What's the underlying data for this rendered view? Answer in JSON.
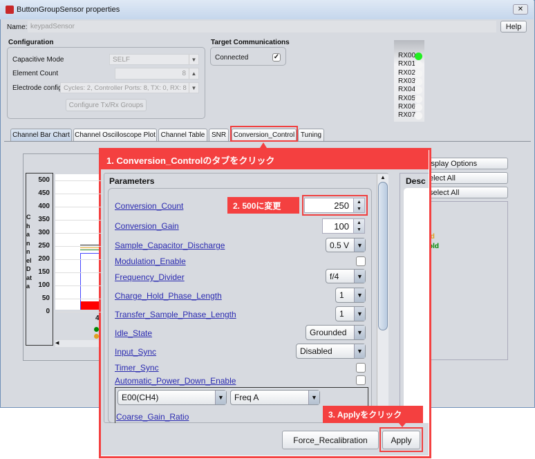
{
  "window": {
    "title": "ButtonGroupSensor properties",
    "help": "Help"
  },
  "name": {
    "label": "Name:",
    "value": "keypadSensor"
  },
  "configuration": {
    "title": "Configuration",
    "capacitive_mode_label": "Capacitive Mode",
    "capacitive_mode": "SELF",
    "element_count_label": "Element Count",
    "element_count": "8",
    "electrode_label": "Electrode config",
    "electrode": "Cycles:  2, Controller Ports:  8, TX:  0, RX:  8",
    "configure_button": "Configure Tx/Rx Groups"
  },
  "target": {
    "title": "Target Communications",
    "connected_label": "Connected",
    "connected": true
  },
  "rx": [
    {
      "label": "RX00",
      "active": true
    },
    {
      "label": "RX01",
      "active": false
    },
    {
      "label": "RX02",
      "active": false
    },
    {
      "label": "RX03",
      "active": false
    },
    {
      "label": "RX04",
      "active": false
    },
    {
      "label": "RX05",
      "active": false
    },
    {
      "label": "RX06",
      "active": false
    },
    {
      "label": "RX07",
      "active": false
    }
  ],
  "tabs": [
    "Channel Bar Chart",
    "Channel Oscilloscope Plot",
    "Channel Table",
    "SNR",
    "Conversion_Control",
    "Tuning"
  ],
  "chart": {
    "ylabel": "Channel Data",
    "yticks": [
      "500",
      "450",
      "400",
      "350",
      "300",
      "250",
      "200",
      "150",
      "100",
      "50",
      "0"
    ],
    "xtick": "4"
  },
  "side": {
    "display_options": "isplay Options",
    "select_all": "elect All",
    "deselect_all": "select All",
    "legend1": "ld",
    "legend2": "old",
    "desc": "Desc"
  },
  "annotations": {
    "step1": "1. Conversion_Controlのタブをクリック",
    "step2": "2. 500に変更",
    "step3": "3. Applyをクリック"
  },
  "parameters": {
    "title": "Parameters",
    "conversion_count_label": "Conversion_Count",
    "conversion_count": "250",
    "conversion_gain_label": "Conversion_Gain",
    "conversion_gain": "100",
    "sample_cap_label": "Sample_Capacitor_Discharge",
    "sample_cap": "0.5 V",
    "modulation_label": "Modulation_Enable",
    "freq_div_label": "Frequency_Divider",
    "freq_div": "f/4",
    "charge_hold_label": "Charge_Hold_Phase_Length",
    "charge_hold": "1",
    "transfer_label": "Transfer_Sample_Phase_Length",
    "transfer": "1",
    "idle_label": "Idle_State",
    "idle": "Grounded",
    "input_sync_label": "Input_Sync",
    "input_sync": "Disabled",
    "timer_sync_label": "Timer_Sync",
    "apd_label": "Automatic_Power_Down_Enable",
    "element_select": "E00(CH4)",
    "freq_select": "Freq A",
    "coarse_label": "Coarse_Gain_Ratio"
  },
  "buttons": {
    "force": "Force_Recalibration",
    "apply": "Apply"
  },
  "colors": {
    "accent_red": "#f44040",
    "rx_active": "#22ee22"
  }
}
